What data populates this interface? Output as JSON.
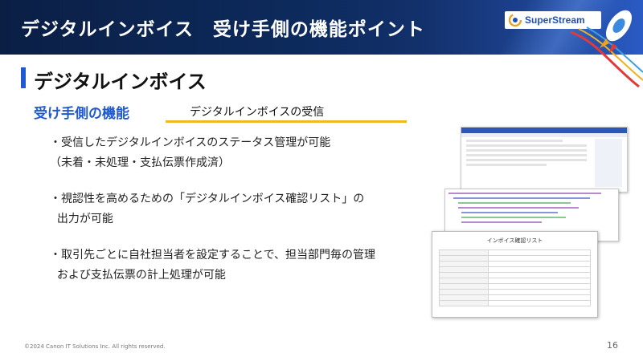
{
  "header": {
    "title": "デジタルインボイス　受け手側の機能ポイント",
    "logo_text": "SuperStream"
  },
  "section": {
    "title": "デジタルインボイス"
  },
  "subheading": {
    "label": "受け手側の機能",
    "text": "デジタルインボイスの受信"
  },
  "bullets": [
    "・受信したデジタルインボイスのステータス管理が可能\n（未着・未処理・支払伝票作成済）",
    "・視認性を高めるための「デジタルインボイス確認リスト」の\n  出力が可能",
    "・取引先ごとに自社担当者を設定することで、担当部門毎の管理\n  および支払伝票の計上処理が可能"
  ],
  "images": {
    "confirm_list_title": "インボイス確認リスト"
  },
  "footer": {
    "copyright": "©2024 Canon IT Solutions Inc. All rights reserved.",
    "page": "16"
  },
  "colors": {
    "header_bg": "#0d2a5c",
    "accent_blue": "#1f5ad0",
    "underline_yellow": "#f2b824"
  }
}
